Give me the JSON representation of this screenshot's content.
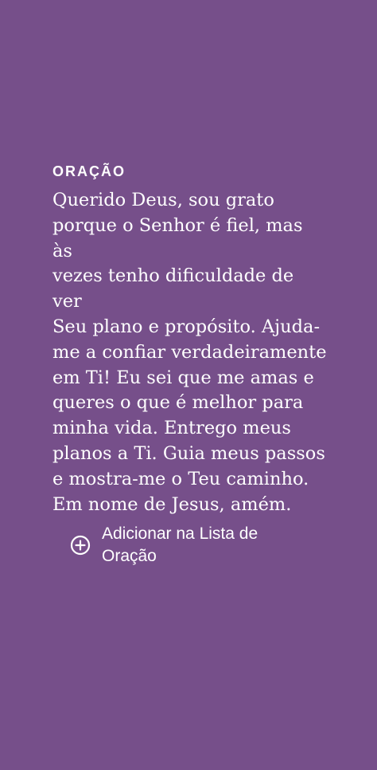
{
  "prayer": {
    "title": "ORAÇÃO",
    "text": "Querido Deus, sou grato\nporque o Senhor é fiel, mas às\nvezes tenho dificuldade de ver\nSeu plano e propósito. Ajuda-\nme a confiar verdadeiramente\nem Ti! Eu sei que me amas e\nqueres o que é melhor para\nminha vida. Entrego meus\nplanos a Ti. Guia meus passos\ne mostra-me o Teu caminho.\nEm nome de Jesus, amém."
  },
  "action": {
    "icon": "add-circle-icon",
    "label": "Adicionar na Lista de\nOração"
  },
  "colors": {
    "background": "#764F8A",
    "text": "#FFFFFF"
  }
}
